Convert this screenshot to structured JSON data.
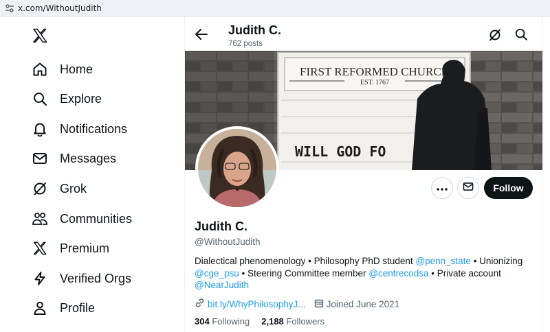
{
  "browser": {
    "url": "x.com/WithoutJudith"
  },
  "nav": {
    "items": [
      {
        "label": "Home"
      },
      {
        "label": "Explore"
      },
      {
        "label": "Notifications"
      },
      {
        "label": "Messages"
      },
      {
        "label": "Grok"
      },
      {
        "label": "Communities"
      },
      {
        "label": "Premium"
      },
      {
        "label": "Verified Orgs"
      },
      {
        "label": "Profile"
      }
    ]
  },
  "header": {
    "name": "Judith C.",
    "posts": "762 posts"
  },
  "banner": {
    "sign_line1": "FIRST REFORMED CHURCH",
    "sign_line2": "EST. 1767",
    "sign_line3": "WILL GOD FO"
  },
  "actions": {
    "follow_label": "Follow"
  },
  "profile": {
    "name": "Judith C.",
    "handle": "@WithoutJudith",
    "bio": {
      "t1": "Dialectical phenomenology • Philosophy PhD student ",
      "m1": "@penn_state",
      "t2": " • Unionizing ",
      "m2": "@cge_psu",
      "t3": " • Steering Committee member ",
      "m3": "@centrecodsa",
      "t4": " • Private account ",
      "m4": "@NearJudith"
    },
    "link": "bit.ly/WhyPhilosophyJ...",
    "joined": "Joined June 2021",
    "following_count": "304",
    "following_label": "Following",
    "followers_count": "2,188",
    "followers_label": "Followers"
  },
  "colors": {
    "accent": "#1d9bf0",
    "text": "#0f1419",
    "muted": "#536471",
    "button_dark": "#0f1419"
  }
}
